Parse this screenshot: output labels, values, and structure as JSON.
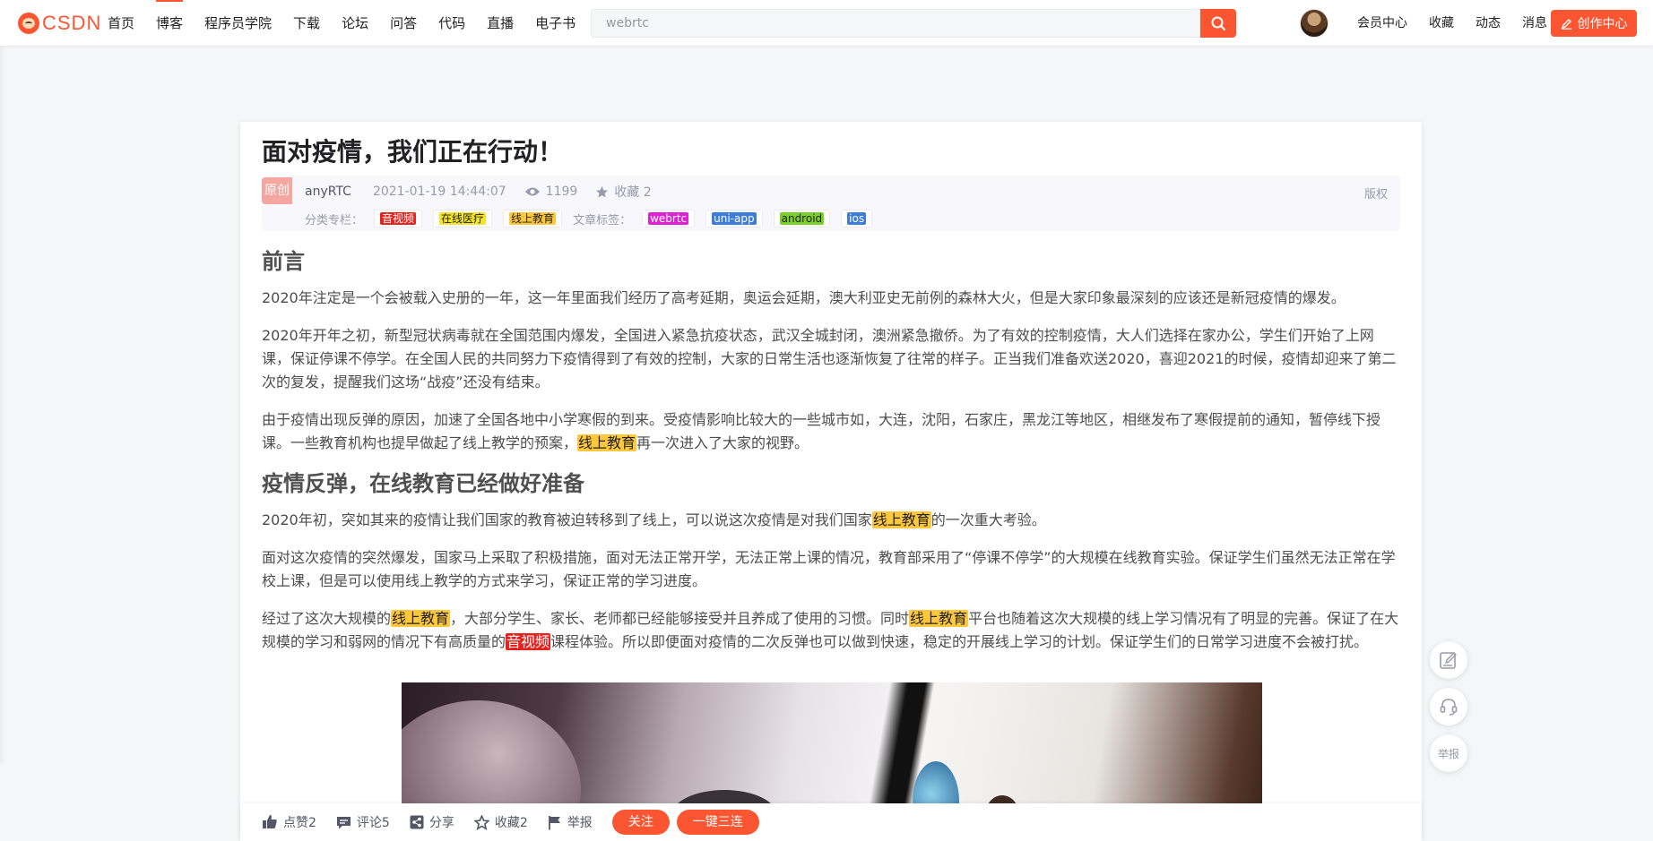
{
  "header": {
    "logo": "CSDN",
    "nav": [
      "首页",
      "博客",
      "程序员学院",
      "下载",
      "论坛",
      "问答",
      "代码",
      "直播",
      "电子书"
    ],
    "search_value": "webrtc",
    "user_nav": [
      "会员中心",
      "收藏",
      "动态",
      "消息"
    ],
    "create_label": "创作中心"
  },
  "article": {
    "title": "面对疫情，我们正在行动！",
    "badge": "原创",
    "author": "anyRTC",
    "date": "2021-01-19 14:44:07",
    "views": "1199",
    "favorites": "收藏 2",
    "copyright": "版权",
    "column_label": "分类专栏：",
    "columns": [
      {
        "label": "音视频",
        "bg": "#e8211d",
        "fg": "#ffffff"
      },
      {
        "label": "在线医疗",
        "bg": "#f5e42a",
        "fg": "#222222"
      },
      {
        "label": "线上教育",
        "bg": "#ffc83c",
        "fg": "#222222"
      }
    ],
    "tag_label": "文章标签：",
    "tags": [
      {
        "label": "webrtc",
        "bg": "#e020d6",
        "fg": "#ffffff"
      },
      {
        "label": "uni-app",
        "bg": "#3d7dd9",
        "fg": "#ffffff"
      },
      {
        "label": "android",
        "bg": "#7ccf2a",
        "fg": "#222222"
      },
      {
        "label": "ios",
        "bg": "#3d7dd9",
        "fg": "#ffffff"
      }
    ],
    "h1": "前言",
    "p1": "2020年注定是一个会被载入史册的一年，这一年里面我们经历了高考延期，奥运会延期，澳大利亚史无前例的森林大火，但是大家印象最深刻的应该还是新冠疫情的爆发。",
    "p2": "2020年开年之初，新型冠状病毒就在全国范围内爆发，全国进入紧急抗疫状态，武汉全城封闭，澳洲紧急撤侨。为了有效的控制疫情，大人们选择在家办公，学生们开始了上网课，保证停课不停学。在全国人民的共同努力下疫情得到了有效的控制，大家的日常生活也逐渐恢复了往常的样子。正当我们准备欢送2020，喜迎2021的时候，疫情却迎来了第二次的复发，提醒我们这场“战疫”还没有结束。",
    "p3_a": "由于疫情出现反弹的原因，加速了全国各地中小学寒假的到来。受疫情影响比较大的一些城市如，大连，沈阳，石家庄，黑龙江等地区，相继发布了寒假提前的通知，暂停线下授课。一些教育机构也提早做起了线上教学的预案，",
    "p3_hl": "线上教育",
    "p3_b": "再一次进入了大家的视野。",
    "h2": "疫情反弹，在线教育已经做好准备",
    "p4_a": "2020年初，突如其来的疫情让我们国家的教育被迫转移到了线上，可以说这次疫情是对我们国家",
    "p4_hl": "线上教育",
    "p4_b": "的一次重大考验。",
    "p5": "面对这次疫情的突然爆发，国家马上采取了积极措施，面对无法正常开学，无法正常上课的情况，教育部采用了“停课不停学”的大规模在线教育实验。保证学生们虽然无法正常在学校上课，但是可以使用线上教学的方式来学习，保证正常的学习进度。",
    "p6_a": "经过了这次大规模的",
    "p6_hl1": "线上教育",
    "p6_b": "，大部分学生、家长、老师都已经能够接受并且养成了使用的习惯。同时",
    "p6_hl2": "线上教育",
    "p6_c": "平台也随着这次大规模的线上学习情况有了明显的完善。保证了在大规模的学习和弱网的情况下有高质量的",
    "p6_hl3": "音视频",
    "p6_d": "课程体验。所以即便面对疫情的二次反弹也可以做到快速，稳定的开展线上学习的计划。保证学生们的日常学习进度不会被打扰。"
  },
  "toolbar": {
    "like": "点赞2",
    "comment": "评论5",
    "share": "分享",
    "favorite": "收藏2",
    "report": "举报",
    "follow": "关注",
    "triple": "一键三连"
  },
  "float": {
    "report": "举报"
  }
}
